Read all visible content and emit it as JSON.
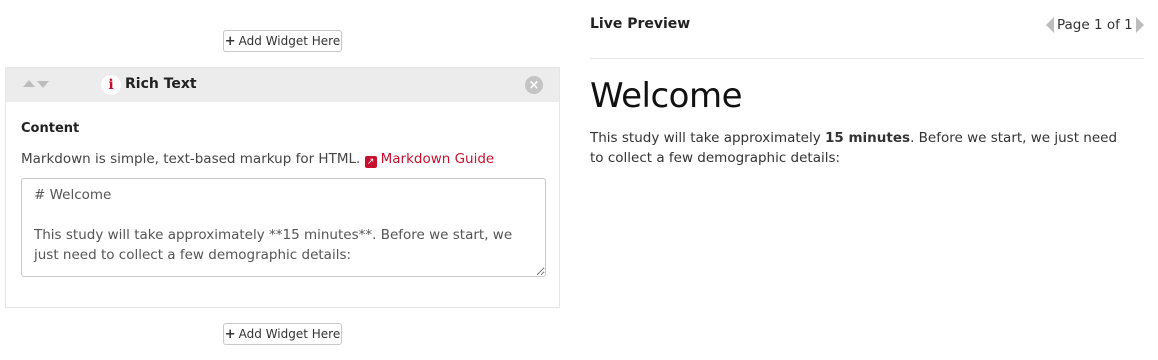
{
  "add_widget": {
    "label": "Add Widget Here"
  },
  "widget": {
    "title": "Rich Text",
    "content_label": "Content",
    "help_text": "Markdown is simple, text-based markup for HTML.",
    "guide_link": "Markdown Guide",
    "editor_value": "# Welcome\n\nThis study will take approximately **15 minutes**. Before we start, we just need to collect a few demographic details:"
  },
  "preview": {
    "title": "Live Preview",
    "pager": "Page 1 of 1",
    "heading": "Welcome",
    "body_prefix": "This study will take approximately ",
    "body_bold": "15 minutes",
    "body_suffix": ". Before we start, we just need to collect a few demographic details:"
  },
  "colors": {
    "accent": "#c8102e",
    "header_bg": "#ececec",
    "border": "#c8c8c8"
  }
}
